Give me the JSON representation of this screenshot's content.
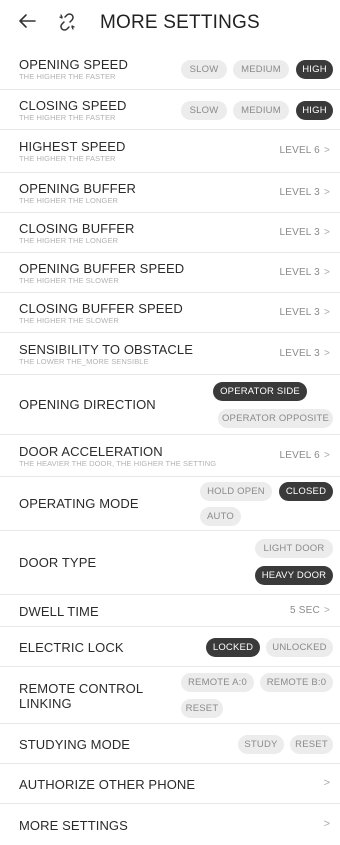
{
  "header": {
    "back_icon": "arrow-left-icon",
    "unlink_icon": "unlink-icon",
    "title": "MORE SETTINGS"
  },
  "opening_speed": {
    "label": "OPENING SPEED",
    "sub": "THE HIGHER THE FASTER",
    "options": [
      "SLOW",
      "MEDIUM",
      "HIGH"
    ],
    "selected": "HIGH"
  },
  "closing_speed": {
    "label": "CLOSING SPEED",
    "sub": "THE HIGHER THE FASTER",
    "options": [
      "SLOW",
      "MEDIUM",
      "HIGH"
    ],
    "selected": "HIGH"
  },
  "highest_speed": {
    "label": "HIGHEST SPEED",
    "sub": "THE HIGHER THE FASTER",
    "value": "LEVEL 6"
  },
  "opening_buffer": {
    "label": "OPENING BUFFER",
    "sub": "THE HIGHER THE LONGER",
    "value": "LEVEL 3"
  },
  "closing_buffer": {
    "label": "CLOSING BUFFER",
    "sub": "THE HIGHER THE LONGER",
    "value": "LEVEL 3"
  },
  "opening_buffer_speed": {
    "label": "OPENING BUFFER SPEED",
    "sub": "THE HIGHER THE SLOWER",
    "value": "LEVEL 3"
  },
  "closing_buffer_speed": {
    "label": "CLOSING BUFFER SPEED",
    "sub": "THE HIGHER THE SLOWER",
    "value": "LEVEL 3"
  },
  "sensibility": {
    "label": "SENSIBILITY TO OBSTACLE",
    "sub": "THE LOWER THE_MORE SENSIBLE",
    "value": "LEVEL 3"
  },
  "opening_direction": {
    "label": "OPENING DIRECTION",
    "options": [
      "OPERATOR SIDE",
      "OPERATOR OPPOSITE"
    ],
    "selected": "OPERATOR SIDE"
  },
  "door_acceleration": {
    "label": "DOOR ACCELERATION",
    "sub": "THE HEAVIER THE DOOR, THE HIGHER THE SETTING",
    "value": "LEVEL 6"
  },
  "operating_mode": {
    "label": "OPERATING MODE",
    "options": [
      "HOLD OPEN",
      "CLOSED",
      "AUTO"
    ],
    "selected": "CLOSED"
  },
  "door_type": {
    "label": "DOOR TYPE",
    "options": [
      "LIGHT DOOR",
      "HEAVY DOOR"
    ],
    "selected": "HEAVY DOOR"
  },
  "dwell_time": {
    "label": "DWELL TIME",
    "value": "5 SEC"
  },
  "electric_lock": {
    "label": "ELECTRIC LOCK",
    "options": [
      "LOCKED",
      "UNLOCKED"
    ],
    "selected": "LOCKED"
  },
  "remote_control": {
    "label_line1": "REMOTE CONTROL",
    "label_line2": "LINKING",
    "options": [
      "REMOTE A:0",
      "REMOTE B:0",
      "RESET"
    ]
  },
  "studying_mode": {
    "label": "STUDYING MODE",
    "options": [
      "STUDY",
      "RESET"
    ]
  },
  "authorize": {
    "label": "AUTHORIZE OTHER PHONE"
  },
  "more_settings": {
    "label": "MORE SETTINGS"
  },
  "chevron": ">",
  "colors": {
    "active": "#3a3a3a",
    "inactive": "#ececec",
    "divider": "#e8e8e8"
  }
}
